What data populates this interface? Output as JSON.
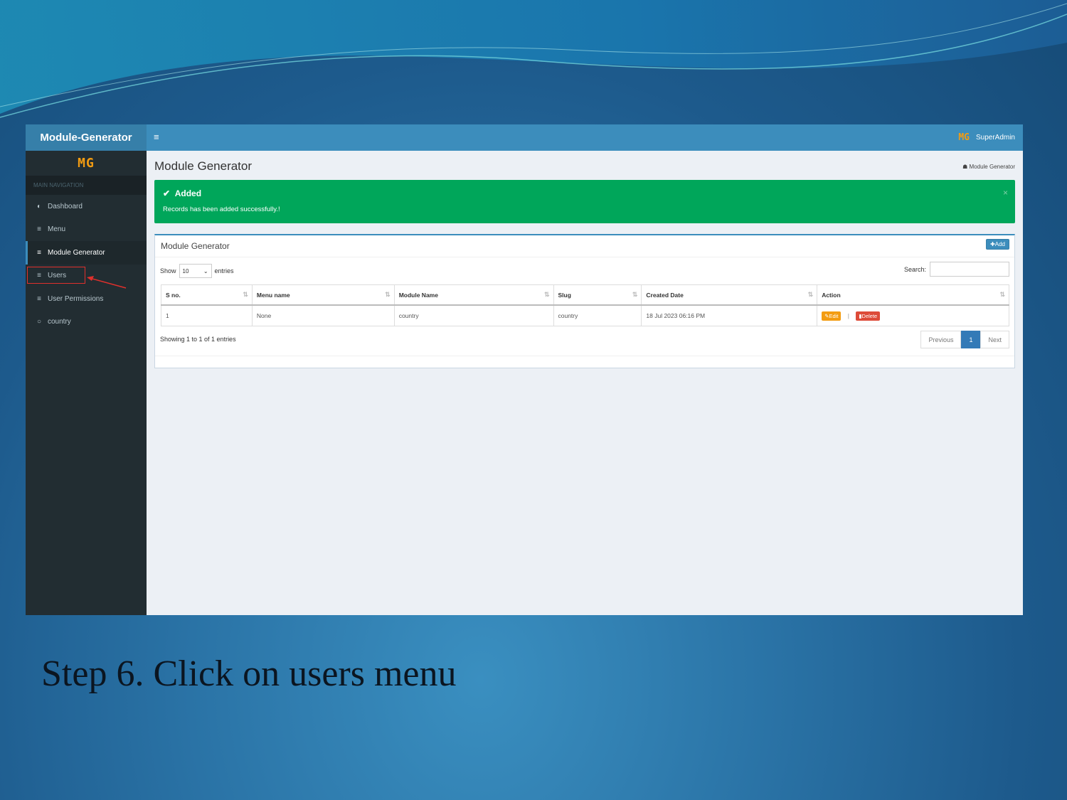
{
  "app": {
    "brand": "Module-Generator",
    "logo": "MG",
    "user_avatar": "MG",
    "user_name": "SuperAdmin"
  },
  "sidebar": {
    "header": "MAIN NAVIGATION",
    "items": [
      {
        "label": "Dashboard",
        "icon": "dashboard-icon"
      },
      {
        "label": "Menu",
        "icon": "bars-icon"
      },
      {
        "label": "Module Generator",
        "icon": "bars-icon"
      },
      {
        "label": "Users",
        "icon": "bars-icon"
      },
      {
        "label": "User Permissions",
        "icon": "bars-icon"
      },
      {
        "label": "country",
        "icon": "circle-icon"
      }
    ]
  },
  "page": {
    "title": "Module Generator",
    "breadcrumb": "Module Generator"
  },
  "alert": {
    "title": "Added",
    "message": "Records has been added successfully.!",
    "close": "×"
  },
  "box": {
    "title": "Module Generator",
    "add_label": "Add",
    "show_label": "Show",
    "entries_value": "10",
    "entries_label": "entries",
    "search_label": "Search:",
    "info": "Showing 1 to 1 of 1 entries"
  },
  "table": {
    "headers": [
      "S no.",
      "Menu name",
      "Module Name",
      "Slug",
      "Created Date",
      "Action"
    ],
    "rows": [
      {
        "sno": "1",
        "menu": "None",
        "module": "country",
        "slug": "country",
        "date": "18 Jul 2023 06:16 PM",
        "edit": "Edit",
        "delete": "Delete"
      }
    ]
  },
  "pager": {
    "prev": "Previous",
    "page": "1",
    "next": "Next"
  },
  "caption": "Step 6. Click on users menu",
  "colors": {
    "accent": "#3c8dbc",
    "success": "#00a65a",
    "warning": "#f39c12",
    "danger": "#dd4b39",
    "sidebar": "#222d32"
  }
}
